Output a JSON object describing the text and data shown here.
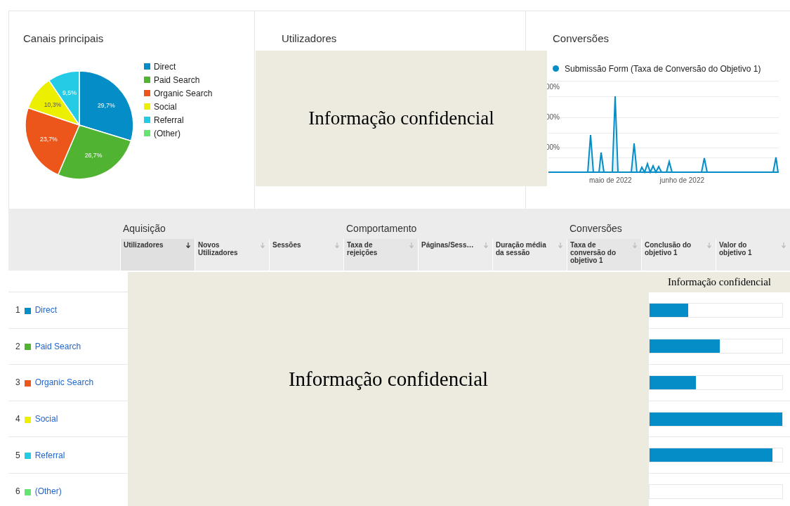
{
  "panels": {
    "channels": {
      "title": "Canais principais",
      "legend": [
        {
          "label": "Direct",
          "color": "#058dc7"
        },
        {
          "label": "Paid Search",
          "color": "#50b432"
        },
        {
          "label": "Organic Search",
          "color": "#ed561b"
        },
        {
          "label": "Social",
          "color": "#edef00"
        },
        {
          "label": "Referral",
          "color": "#24cbe5"
        },
        {
          "label": "(Other)",
          "color": "#64e572"
        }
      ],
      "chart_data": {
        "type": "pie",
        "values": [
          29.7,
          26.7,
          23.7,
          10.3,
          9.5
        ],
        "value_labels": [
          "29,7%",
          "26,7%",
          "23,7%",
          "10,3%",
          "9,5%"
        ]
      }
    },
    "users": {
      "title": "Utilizadores"
    },
    "conversions": {
      "title": "Conversões",
      "series_label": "Submissão Form (Taxa de Conversão do Objetivo 1)",
      "y_labels": [
        "00%",
        "00%",
        "00%"
      ],
      "x_labels": [
        "maio de 2022",
        "junho de 2022"
      ]
    }
  },
  "redactions": {
    "top": "Informação confidencial",
    "table_total": "Informação confidencial",
    "table_body": "Informação confidencial"
  },
  "table": {
    "groups": [
      "Aquisição",
      "Comportamento",
      "Conversões"
    ],
    "columns": [
      {
        "label": "Utilizadores",
        "sorted": true
      },
      {
        "label": "Novos Utilizadores",
        "sorted": false
      },
      {
        "label": "Sessões",
        "sorted": false
      },
      {
        "label": "Taxa de rejeições",
        "sorted": false
      },
      {
        "label": "Páginas/Sess…",
        "sorted": false
      },
      {
        "label": "Duração média da sessão",
        "sorted": false
      },
      {
        "label": "Taxa de conversão do objetivo 1",
        "sorted": false
      },
      {
        "label": "Conclusão do objetivo 1",
        "sorted": false
      },
      {
        "label": "Valor do objetivo 1",
        "sorted": false
      }
    ],
    "rows": [
      {
        "index": "1",
        "channel": "Direct",
        "color": "#058dc7",
        "level": 0.29
      },
      {
        "index": "2",
        "channel": "Paid Search",
        "color": "#50b432",
        "level": 0.53
      },
      {
        "index": "3",
        "channel": "Organic Search",
        "color": "#ed561b",
        "level": 0.35
      },
      {
        "index": "4",
        "channel": "Social",
        "color": "#edef00",
        "level": 1.0
      },
      {
        "index": "5",
        "channel": "Referral",
        "color": "#24cbe5",
        "level": 0.925
      },
      {
        "index": "6",
        "channel": "(Other)",
        "color": "#64e572",
        "level": 0
      }
    ]
  }
}
